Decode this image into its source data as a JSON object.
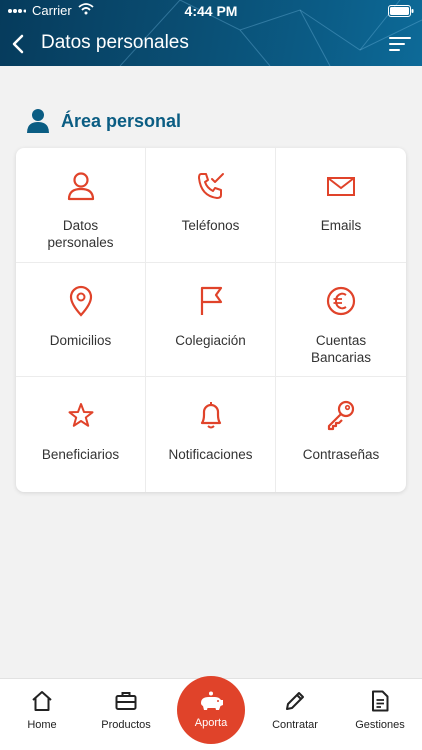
{
  "status": {
    "carrier": "Carrier",
    "time": "4:44 PM"
  },
  "header": {
    "title": "Datos personales"
  },
  "section": {
    "title": "Área personal"
  },
  "grid": [
    {
      "label": "Datos personales",
      "icon": "user-icon"
    },
    {
      "label": "Teléfonos",
      "icon": "phone-check-icon"
    },
    {
      "label": "Emails",
      "icon": "mail-icon"
    },
    {
      "label": "Domicilios",
      "icon": "map-pin-icon"
    },
    {
      "label": "Colegiación",
      "icon": "flag-icon"
    },
    {
      "label": "Cuentas Bancarias",
      "icon": "euro-icon"
    },
    {
      "label": "Beneficiarios",
      "icon": "star-icon"
    },
    {
      "label": "Notificaciones",
      "icon": "bell-icon"
    },
    {
      "label": "Contraseñas",
      "icon": "key-icon"
    }
  ],
  "tabs": {
    "home": "Home",
    "productos": "Productos",
    "aporta": "Aporta",
    "contratar": "Contratar",
    "gestiones": "Gestiones"
  },
  "colors": {
    "accent": "#e0432a",
    "primary": "#0b5d83",
    "header": "#0a4e73"
  }
}
